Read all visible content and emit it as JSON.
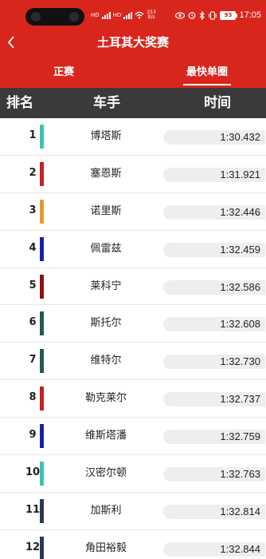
{
  "status_bar": {
    "net_speed_value": "253",
    "net_speed_unit": "B/s",
    "battery": "93",
    "time": "17:05"
  },
  "header": {
    "title": "土耳其大奖赛",
    "tabs": [
      {
        "label": "正赛",
        "active": false
      },
      {
        "label": "最快单圈",
        "active": true
      }
    ]
  },
  "table": {
    "columns": [
      "排名",
      "车手",
      "时间"
    ],
    "rows": [
      {
        "rank": "1",
        "driver": "博塔斯",
        "time": "1:30.432",
        "team_color": "#3fc2b3"
      },
      {
        "rank": "2",
        "driver": "塞恩斯",
        "time": "1:31.921",
        "team_color": "#c8201e"
      },
      {
        "rank": "3",
        "driver": "诺里斯",
        "time": "1:32.446",
        "team_color": "#e59b2e"
      },
      {
        "rank": "4",
        "driver": "佩雷兹",
        "time": "1:32.459",
        "team_color": "#1a22a8"
      },
      {
        "rank": "5",
        "driver": "莱科宁",
        "time": "1:32.586",
        "team_color": "#8b1212"
      },
      {
        "rank": "6",
        "driver": "斯托尔",
        "time": "1:32.608",
        "team_color": "#1f5c4f"
      },
      {
        "rank": "7",
        "driver": "维特尔",
        "time": "1:32.730",
        "team_color": "#1f5c4f"
      },
      {
        "rank": "8",
        "driver": "勒克莱尔",
        "time": "1:32.737",
        "team_color": "#c8201e"
      },
      {
        "rank": "9",
        "driver": "维斯塔潘",
        "time": "1:32.759",
        "team_color": "#1a22a8"
      },
      {
        "rank": "10",
        "driver": "汉密尔顿",
        "time": "1:32.763",
        "team_color": "#3fc2b3"
      },
      {
        "rank": "11",
        "driver": "加斯利",
        "time": "1:32.814",
        "team_color": "#2a3a55"
      },
      {
        "rank": "12",
        "driver": "角田裕毅",
        "time": "1:32.844",
        "team_color": "#2a3a55"
      }
    ]
  },
  "colors": {
    "header_red": "#d9261c",
    "column_header_bg": "#3a3a3a",
    "time_pill_bg": "#eeeeee"
  },
  "icons": {
    "back": "chevron-left-icon",
    "camera": "camera-icon",
    "signal": "signal-icon",
    "wifi": "wifi-icon",
    "eye": "eye-icon",
    "alarm": "alarm-icon",
    "bluetooth": "bluetooth-icon",
    "vibrate": "vibrate-icon",
    "battery": "battery-icon"
  }
}
